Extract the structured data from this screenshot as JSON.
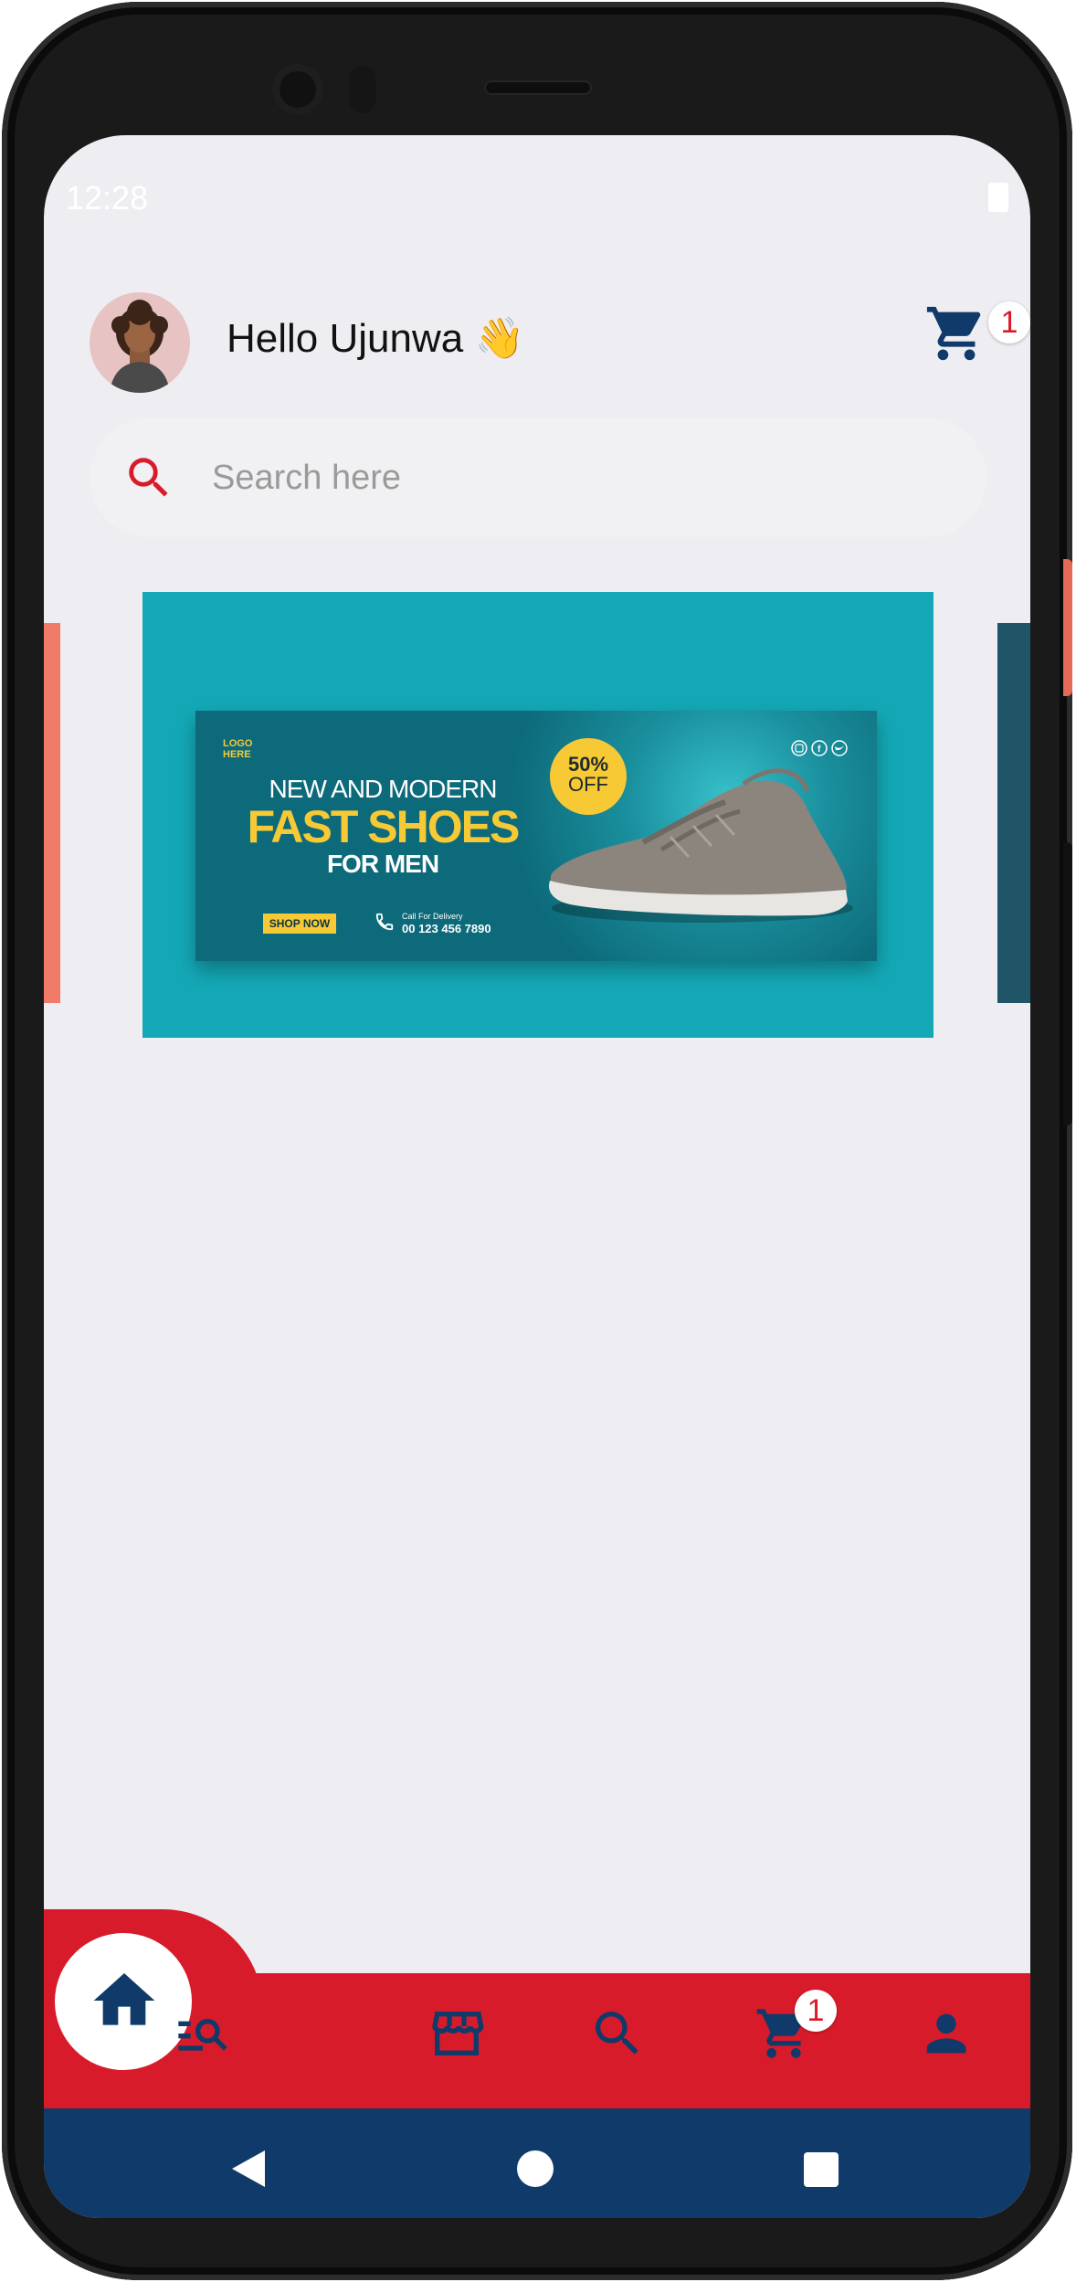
{
  "status_bar": {
    "time": "12:28"
  },
  "header": {
    "greeting": "Hello Ujunwa 👋",
    "cart_count": "1"
  },
  "search": {
    "placeholder": "Search here"
  },
  "banner": {
    "logo_text": "LOGO HERE",
    "line1": "NEW AND MODERN",
    "line2": "FAST SHOES",
    "line3": "FOR MEN",
    "discount_pct": "50%",
    "discount_word": "OFF",
    "shop_now": "SHOP NOW",
    "call_label": "Call For Delivery",
    "phone": "00 123 456 7890"
  },
  "bottom_nav": {
    "items": [
      {
        "name": "home",
        "icon": "home-icon",
        "active": true
      },
      {
        "name": "categories",
        "icon": "list-search-icon"
      },
      {
        "name": "store",
        "icon": "store-icon"
      },
      {
        "name": "search",
        "icon": "search-icon"
      },
      {
        "name": "cart",
        "icon": "cart-icon",
        "badge": "1"
      },
      {
        "name": "profile",
        "icon": "person-icon"
      }
    ]
  },
  "colors": {
    "primary_red": "#d81b2a",
    "navy": "#0f3a6a",
    "banner_teal": "#14a8b6",
    "accent_yellow": "#f6c935",
    "background": "#eeedf2"
  }
}
